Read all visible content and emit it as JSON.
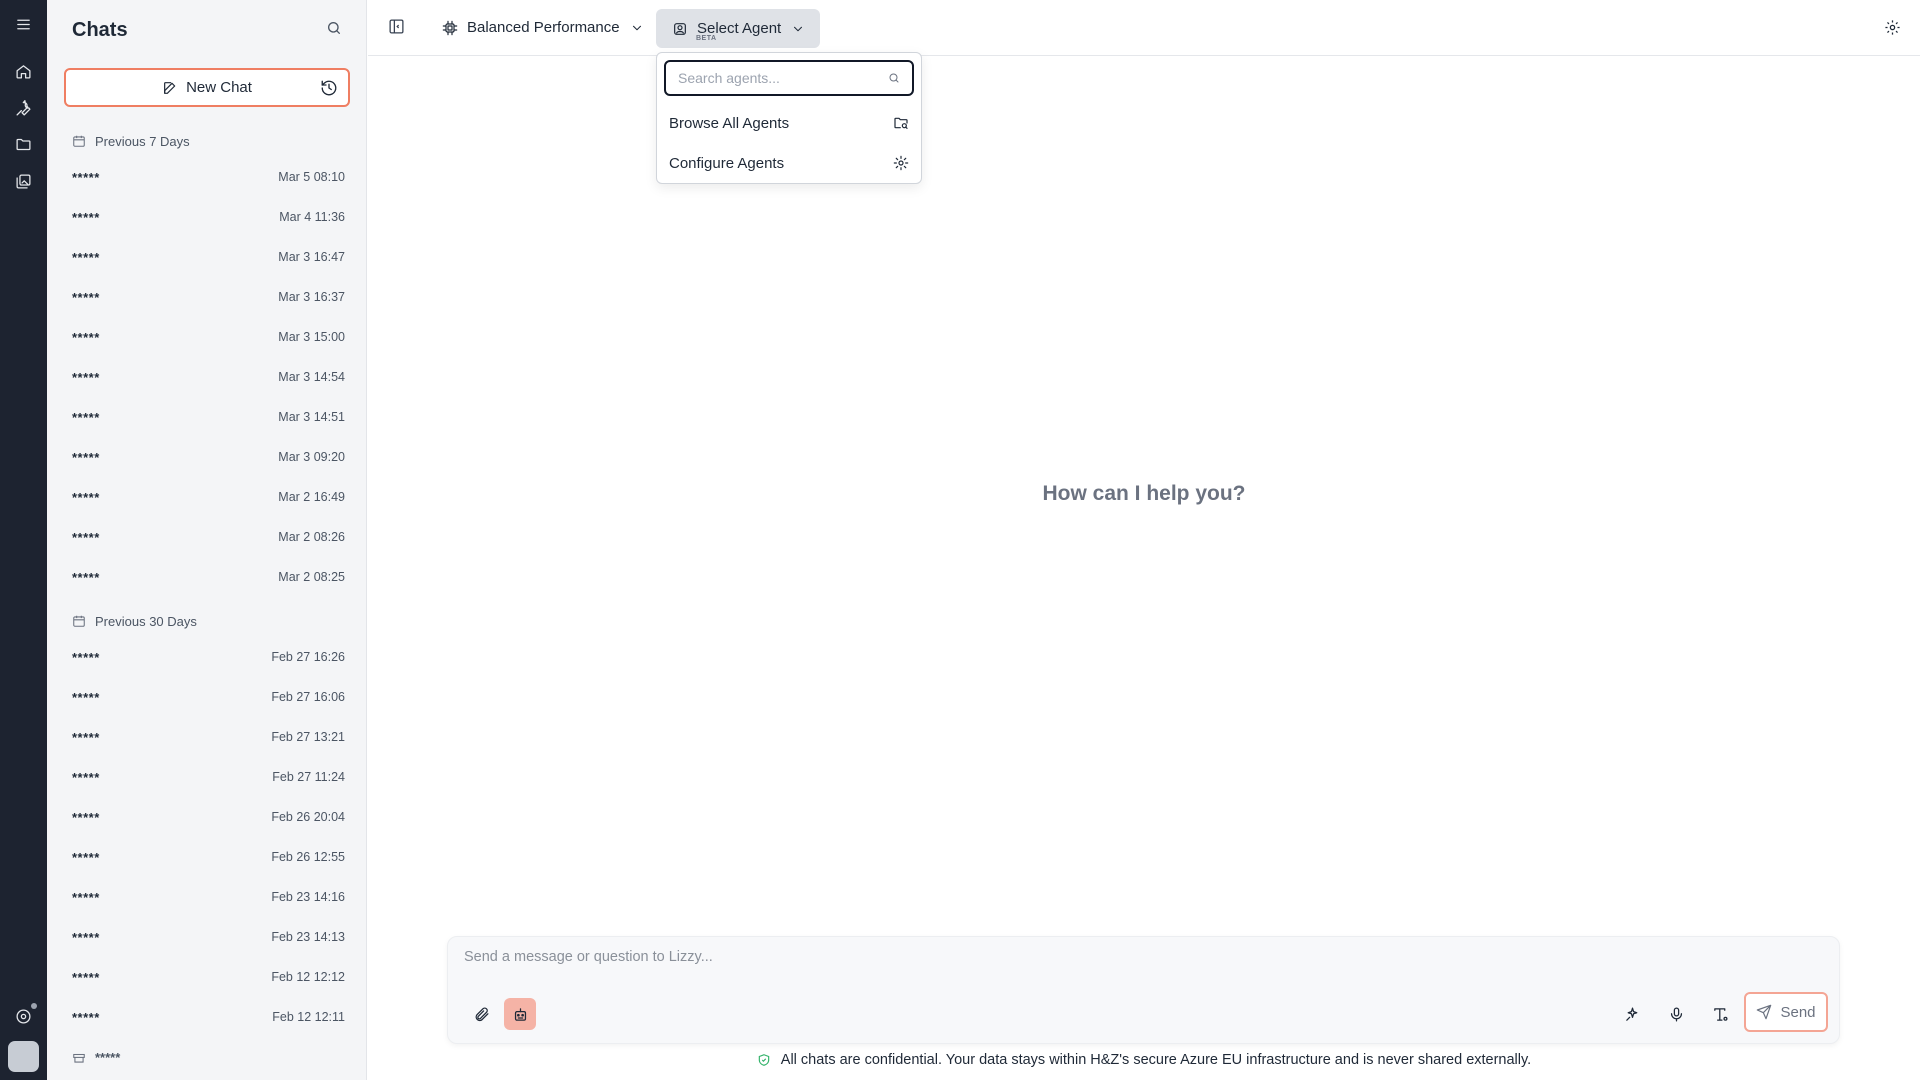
{
  "rail": {
    "items": [
      {
        "icon": "menu-icon"
      },
      {
        "icon": "home-icon"
      },
      {
        "icon": "tools-icon"
      },
      {
        "icon": "folder-icon"
      },
      {
        "icon": "gallery-icon"
      },
      {
        "icon": "support-icon"
      }
    ]
  },
  "sidebar": {
    "title": "Chats",
    "new_chat_label": "New Chat",
    "groups": [
      {
        "label": "Previous 7 Days",
        "chats": [
          {
            "title": "*****",
            "time": "Mar 5 08:10"
          },
          {
            "title": "*****",
            "time": "Mar 4 11:36"
          },
          {
            "title": "*****",
            "time": "Mar 3 16:47"
          },
          {
            "title": "*****",
            "time": "Mar 3 16:37"
          },
          {
            "title": "*****",
            "time": "Mar 3 15:00"
          },
          {
            "title": "*****",
            "time": "Mar 3 14:54"
          },
          {
            "title": "*****",
            "time": "Mar 3 14:51"
          },
          {
            "title": "*****",
            "time": "Mar 3 09:20"
          },
          {
            "title": "*****",
            "time": "Mar 2 16:49"
          },
          {
            "title": "*****",
            "time": "Mar 2 08:26"
          },
          {
            "title": "*****",
            "time": "Mar 2 08:25"
          }
        ]
      },
      {
        "label": "Previous 30 Days",
        "chats": [
          {
            "title": "*****",
            "time": "Feb 27 16:26"
          },
          {
            "title": "*****",
            "time": "Feb 27 16:06"
          },
          {
            "title": "*****",
            "time": "Feb 27 13:21"
          },
          {
            "title": "*****",
            "time": "Feb 27 11:24"
          },
          {
            "title": "*****",
            "time": "Feb 26 20:04"
          },
          {
            "title": "*****",
            "time": "Feb 26 12:55"
          },
          {
            "title": "*****",
            "time": "Feb 23 14:16"
          },
          {
            "title": "*****",
            "time": "Feb 23 14:13"
          },
          {
            "title": "*****",
            "time": "Feb 12 12:12"
          },
          {
            "title": "*****",
            "time": "Feb 12 12:11"
          }
        ]
      }
    ],
    "bottom_item": "*****"
  },
  "topbar": {
    "model_label": "Balanced Performance",
    "agent_label": "Select Agent",
    "agent_badge": "BETA"
  },
  "agent_dropdown": {
    "search_placeholder": "Search agents...",
    "browse_label": "Browse All Agents",
    "configure_label": "Configure Agents"
  },
  "main": {
    "greeting": "How can I help you?"
  },
  "composer": {
    "placeholder": "Send a message or question to Lizzy...",
    "send_label": "Send"
  },
  "footer": {
    "notice": "All chats are confidential. Your data stays within H&Z's secure Azure EU infrastructure and is never shared externally."
  },
  "colors": {
    "accent": "#ef7e62",
    "rail_bg": "#1d2330",
    "sidebar_bg": "#f4f5f7",
    "secure_green": "#34b36b"
  }
}
